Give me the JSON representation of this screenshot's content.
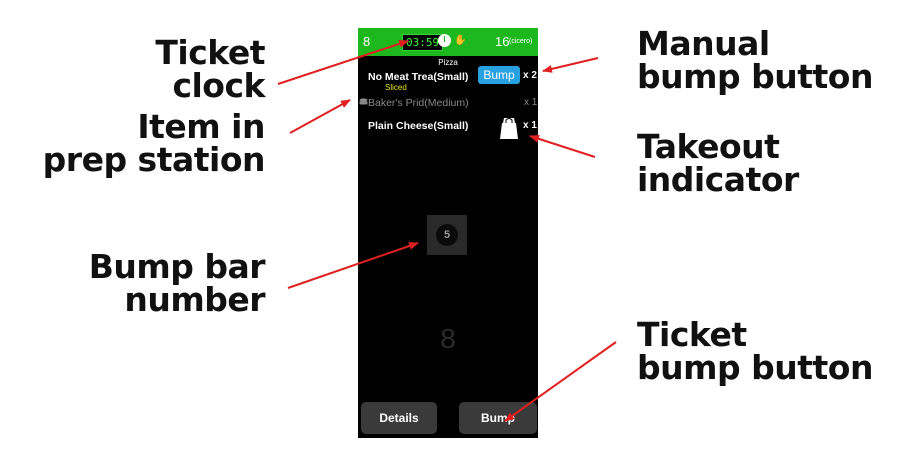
{
  "callouts": {
    "ticket_clock": [
      "Ticket",
      "clock"
    ],
    "item_prep": [
      "Item in",
      "prep station"
    ],
    "bump_bar": [
      "Bump bar",
      "number"
    ],
    "manual_bump": [
      "Manual",
      "bump button"
    ],
    "takeout": [
      "Takeout",
      "indicator"
    ],
    "ticket_bump": [
      "Ticket",
      "bump button"
    ]
  },
  "ticket": {
    "header": {
      "number": "8",
      "clock": "03:59",
      "count": "16",
      "server": "(cicero)",
      "color": "#1db81d"
    },
    "category": "Pizza",
    "items": [
      {
        "name": "No Meat Trea(Small)",
        "modifier": "Sliced",
        "bump_label": "Bump",
        "qty": "x 2"
      },
      {
        "name": "Baker's Prid(Medium)",
        "qty": "x 1",
        "icon": "prep-station-icon"
      },
      {
        "name": "Plain Cheese(Small)",
        "qty": "x 1",
        "icon": "takeout-bag-icon"
      }
    ],
    "bump_bar_number": "5",
    "big_number": "8",
    "footer": {
      "details_label": "Details",
      "bump_label": "Bump"
    }
  },
  "colors": {
    "bump_button": "#29a0e0",
    "modifier": "#e6e61e",
    "arrow": "#e02020"
  }
}
